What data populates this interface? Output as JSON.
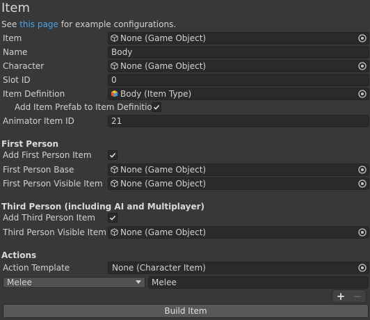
{
  "header": {
    "title": "Item",
    "see_prefix": "See ",
    "see_link": "this page",
    "see_suffix": " for example configurations."
  },
  "fields": {
    "item": {
      "label": "Item",
      "value": "None (Game Object)"
    },
    "name": {
      "label": "Name",
      "value": "Body"
    },
    "character": {
      "label": "Character",
      "value": "None (Game Object)"
    },
    "slot_id": {
      "label": "Slot ID",
      "value": "0"
    },
    "item_definition": {
      "label": "Item Definition",
      "value": "Body (Item Type)"
    },
    "add_prefab": {
      "label": "Add Item Prefab to Item Definition",
      "checked": true
    },
    "animator_item_id": {
      "label": "Animator Item ID",
      "value": "21"
    }
  },
  "first_person": {
    "title": "First Person",
    "add_item": {
      "label": "Add First Person Item",
      "checked": true
    },
    "base": {
      "label": "First Person Base",
      "value": "None (Game Object)"
    },
    "visible_item": {
      "label": "First Person Visible Item",
      "value": "None (Game Object)"
    }
  },
  "third_person": {
    "title": "Third Person (including AI and Multiplayer)",
    "add_item": {
      "label": "Add Third Person Item",
      "checked": true
    },
    "visible_item": {
      "label": "Third Person Visible Item",
      "value": "None (Game Object)"
    }
  },
  "actions": {
    "title": "Actions",
    "template": {
      "label": "Action Template",
      "value": "None (Character Item)"
    },
    "dropdown_value": "Melee",
    "name_value": "Melee",
    "plus": "+",
    "minus": "−"
  },
  "build_button": "Build Item",
  "colors": {
    "link": "#4aa3e8",
    "background": "#383838",
    "field": "#2a2a2a"
  }
}
